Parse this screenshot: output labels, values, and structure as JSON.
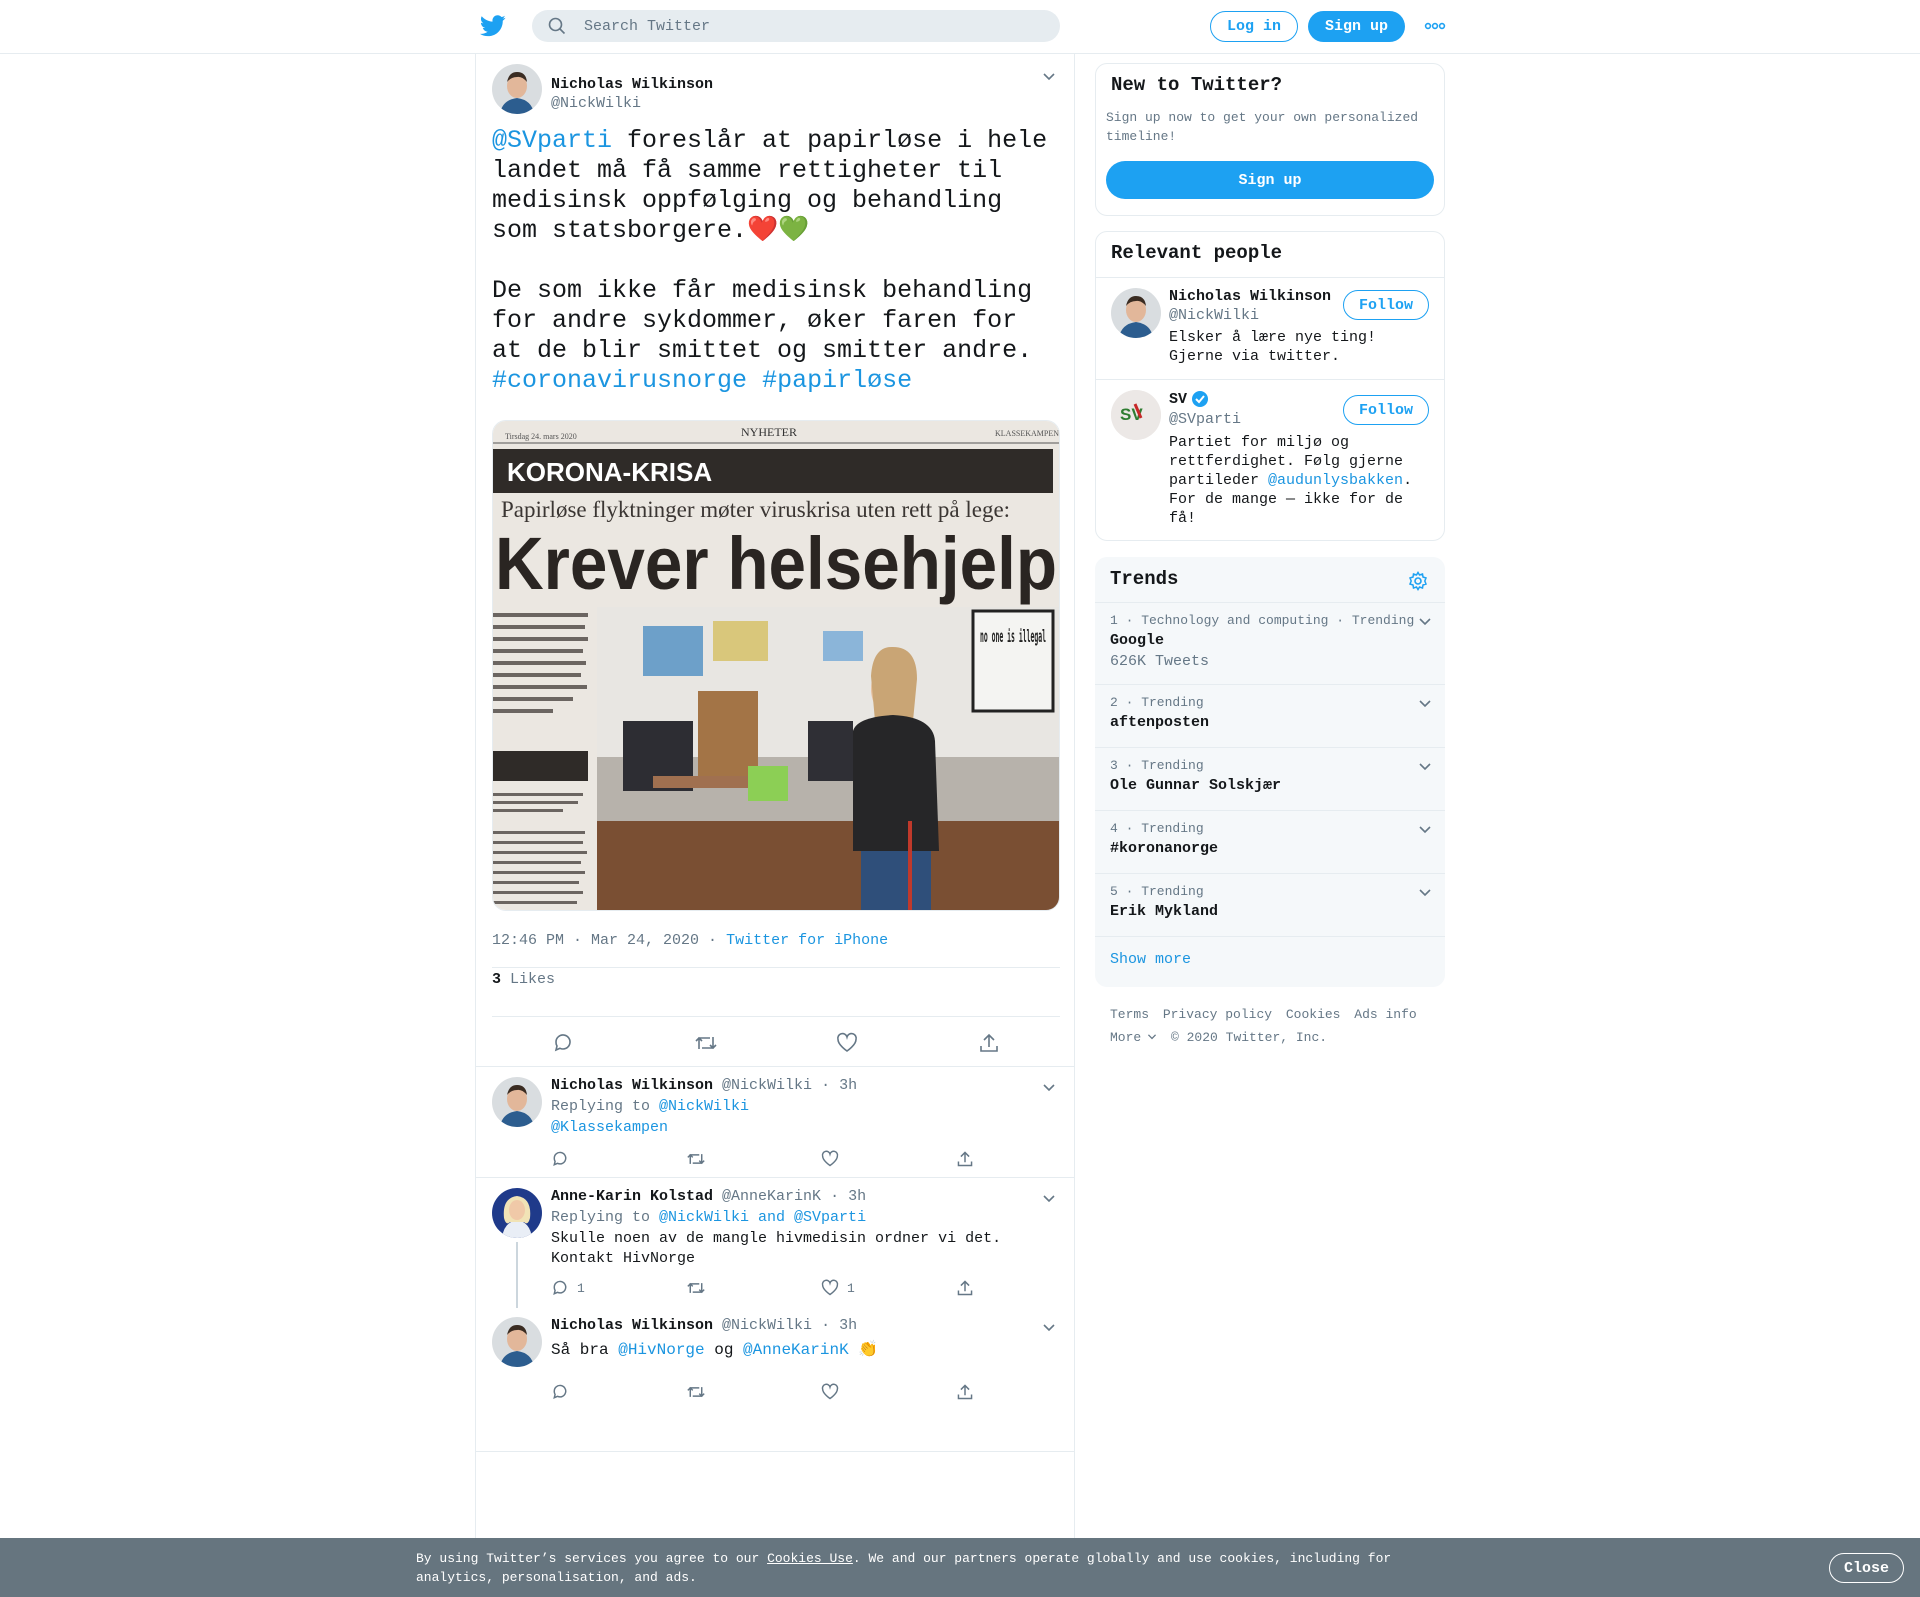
{
  "header": {
    "search_placeholder": "Search Twitter",
    "login_label": "Log in",
    "signup_label": "Sign up",
    "brand_color": "#1da1f2"
  },
  "tweet": {
    "author_name": "Nicholas Wilkinson",
    "author_handle": "@NickWilki",
    "mention": "@SVparti",
    "text_part1": " foreslår at papirløse i hele landet må få samme rettigheter til medisinsk oppfølging og behandling som statsborgere.",
    "emojis": "❤️💚",
    "text_part2": "De som ikke får medisinsk behandling for andre sykdommer, øker faren for at de blir smittet og smitter andre.",
    "hashtag1": "#coronavirusnorge",
    "hashtag2": "#papirløse",
    "photo": {
      "paper_date": "Tirsdag 24. mars 2020",
      "paper_section": "NYHETER",
      "paper_name": "KLASSEKAMPEN",
      "kicker": "KORONA-KRISA",
      "subhead": "Papirløse flyktninger møter viruskrisa uten rett på lege:",
      "headline": "Krever helsehjelp",
      "sign_text": "no one is illegal"
    },
    "timestamp": "12:46 PM · Mar 24, 2020",
    "source": "Twitter for iPhone",
    "likes_count": "3",
    "likes_label": "Likes"
  },
  "replies": [
    {
      "name": "Nicholas Wilkinson",
      "handle": "@NickWilki",
      "time": "· 3h",
      "replying_prefix": "Replying to ",
      "replying_to": "@NickWilki",
      "replying_to2": "@Klassekampen",
      "reply_count": "",
      "like_count": ""
    },
    {
      "name": "Anne-Karin Kolstad",
      "handle": "@AnneKarinK",
      "time": "· 3h",
      "replying_prefix": "Replying to ",
      "replying_to": "@NickWilki and @SVparti",
      "text": "Skulle noen av de mangle hivmedisin ordner vi det. Kontakt HivNorge",
      "reply_count": "1",
      "like_count": "1"
    },
    {
      "name": "Nicholas Wilkinson",
      "handle": "@NickWilki",
      "time": "· 3h",
      "text_prefix": "Så bra ",
      "mention1": "@HivNorge",
      "text_mid": " og ",
      "mention2": "@AnneKarinK",
      "emoji": "👏"
    }
  ],
  "sidebar": {
    "new_title": "New to Twitter?",
    "new_sub": "Sign up now to get your own personalized timeline!",
    "signup_label": "Sign up",
    "relevant_title": "Relevant people",
    "people": [
      {
        "name": "Nicholas Wilkinson",
        "handle": "@NickWilki",
        "bio": "Elsker å lære nye ting! Gjerne via twitter.",
        "follow_label": "Follow"
      },
      {
        "name": "SV",
        "handle": "@SVparti",
        "bio_prefix": "Partiet for miljø og rettferdighet. Følg gjerne partileder ",
        "bio_link": "@audunlysbakken",
        "bio_suffix": ". For de mange — ikke for de få!",
        "follow_label": "Follow",
        "logo_text": "SV"
      }
    ],
    "trends_title": "Trends",
    "trends": [
      {
        "meta": "1 · Technology and computing · Trending",
        "name": "Google",
        "count": "626K Tweets"
      },
      {
        "meta": "2 · Trending",
        "name": "aftenposten"
      },
      {
        "meta": "3 · Trending",
        "name": "Ole Gunnar Solskjær"
      },
      {
        "meta": "4 · Trending",
        "name": "#koronanorge"
      },
      {
        "meta": "5 · Trending",
        "name": "Erik Mykland"
      }
    ],
    "show_more": "Show more",
    "footer": {
      "terms": "Terms",
      "privacy": "Privacy policy",
      "cookies": "Cookies",
      "ads": "Ads info",
      "more": "More",
      "copyright": "© 2020 Twitter, Inc."
    }
  },
  "cookie_bar": {
    "text_prefix": "By using Twitter’s services you agree to our ",
    "link": "Cookies Use",
    "text_suffix": ". We and our partners operate globally and use cookies, including for analytics, personalisation, and ads.",
    "close_label": "Close"
  }
}
